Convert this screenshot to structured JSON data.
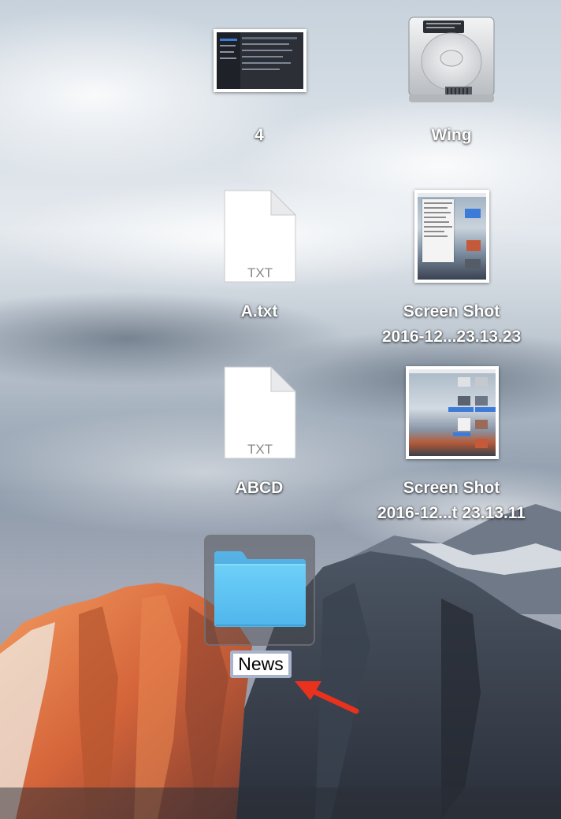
{
  "desktop": {
    "icons": [
      {
        "name": "4",
        "kind": "screenshot-image"
      },
      {
        "name": "Wing",
        "kind": "hard-drive"
      },
      {
        "name": "A.txt",
        "kind": "text-file",
        "ext_badge": "TXT"
      },
      {
        "name": "Screen Shot\n2016-12...23.13.23",
        "kind": "screenshot-image"
      },
      {
        "name": "ABCD",
        "kind": "text-file",
        "ext_badge": "TXT"
      },
      {
        "name": "Screen Shot\n2016-12...t 23.13.11",
        "kind": "screenshot-image"
      },
      {
        "name": "News",
        "kind": "folder",
        "state": "renaming"
      }
    ]
  },
  "colors": {
    "folder": "#5ec6f3",
    "selection_ring": "#a9b4cc",
    "pointer_arrow": "#e8321e"
  }
}
